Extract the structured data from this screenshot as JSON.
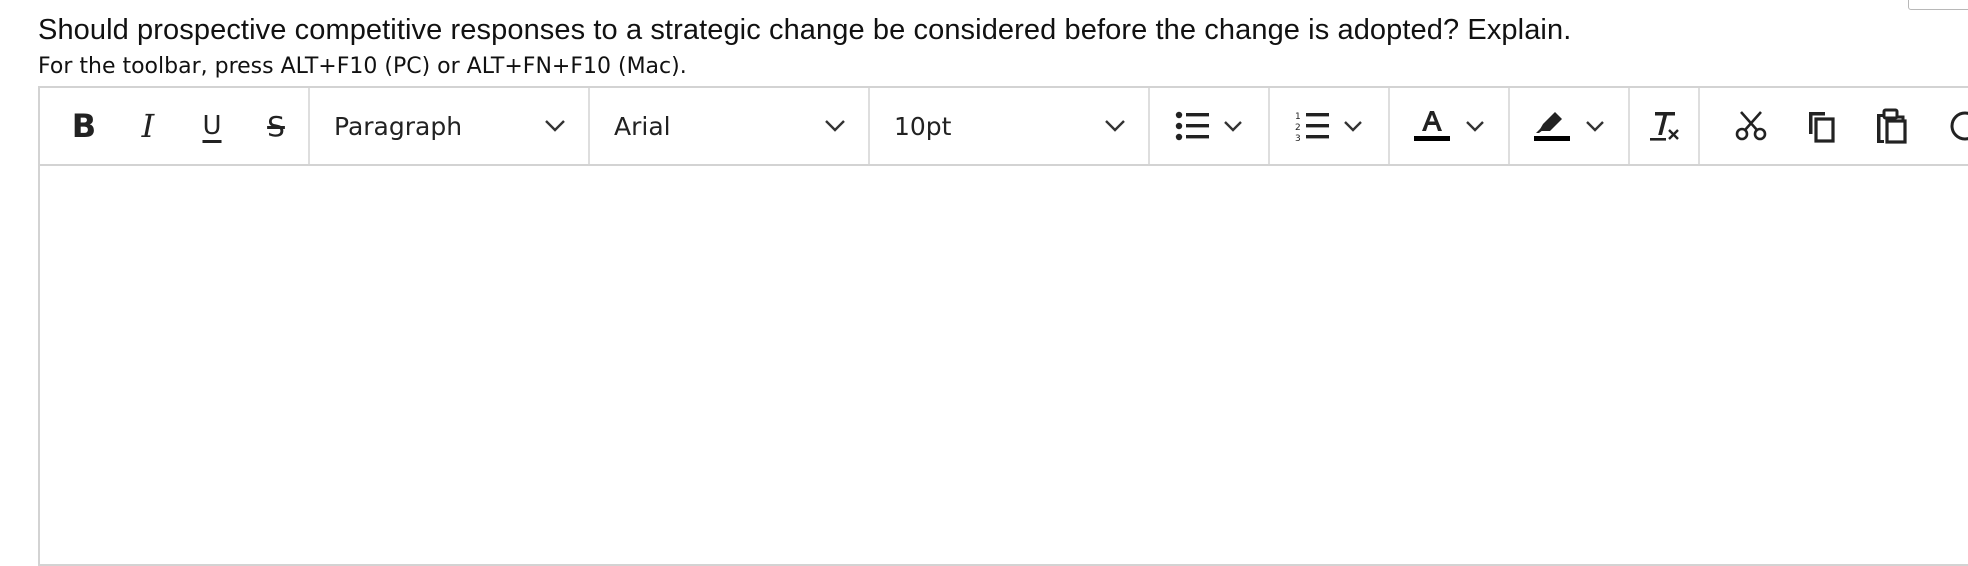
{
  "question": {
    "text": "Should prospective competitive responses to a strategic change be considered before the change is adopted? Explain."
  },
  "toolbar_hint": "For the toolbar, press ALT+F10 (PC) or ALT+FN+F10 (Mac).",
  "toolbar": {
    "bold_label": "B",
    "italic_label": "I",
    "underline_label": "U",
    "strike_label": "S",
    "block_format": {
      "selected": "Paragraph"
    },
    "font_family": {
      "selected": "Arial"
    },
    "font_size": {
      "selected": "10pt"
    },
    "icons": [
      "bullet-list-icon",
      "numbered-list-icon",
      "text-color-icon",
      "highlight-icon",
      "clear-formatting-icon",
      "cut-icon",
      "copy-icon",
      "paste-icon"
    ]
  },
  "editor": {
    "content": ""
  },
  "colors": {
    "border": "#d3d3d3",
    "icon": "#222222",
    "text": "#111111"
  }
}
